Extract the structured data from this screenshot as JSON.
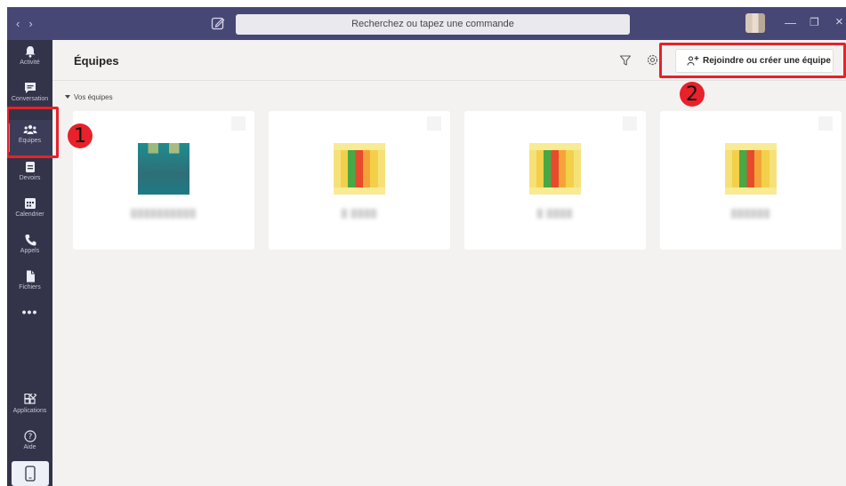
{
  "titlebar": {
    "nav_back": "‹",
    "nav_forward": "›",
    "search_placeholder": "Recherchez ou tapez une commande",
    "minimize": "—",
    "restore": "❐",
    "close": "×"
  },
  "rail": {
    "items": [
      {
        "label": "Activité",
        "icon": "bell-icon"
      },
      {
        "label": "Conversation",
        "icon": "chat-icon"
      },
      {
        "label": "Équipes",
        "icon": "teams-icon",
        "active": true
      },
      {
        "label": "Devoirs",
        "icon": "assignments-icon"
      },
      {
        "label": "Calendrier",
        "icon": "calendar-icon"
      },
      {
        "label": "Appels",
        "icon": "phone-icon"
      },
      {
        "label": "Fichiers",
        "icon": "files-icon"
      }
    ],
    "more": "•••",
    "bottom": [
      {
        "label": "Applications",
        "icon": "apps-icon"
      },
      {
        "label": "Aide",
        "icon": "help-icon"
      }
    ]
  },
  "header": {
    "title": "Équipes",
    "join_button": "Rejoindre ou créer une équipe"
  },
  "section": {
    "label": "Vos équipes"
  },
  "teams": [
    {
      "name": "██████████",
      "tile": "teal"
    },
    {
      "name": "█ ████",
      "tile": "warm"
    },
    {
      "name": "█ ████",
      "tile": "warm"
    },
    {
      "name": "██████",
      "tile": "warm"
    }
  ],
  "annotations": {
    "step1": "1",
    "step2": "2"
  },
  "colors": {
    "titlebar": "#464775",
    "rail": "#33344a",
    "annotation": "#e8212a",
    "accent": "#7f85f5"
  }
}
